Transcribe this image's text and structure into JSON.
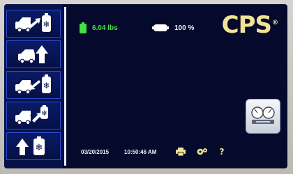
{
  "brand": {
    "logo": "CPS",
    "trademark": "®"
  },
  "status": {
    "weight": "6.04 lbs",
    "battery": "100 %"
  },
  "footer": {
    "date": "03/20/2015",
    "time": "10:50:46 AM",
    "help": "?"
  },
  "sidebar": {
    "items": [
      {
        "icon": "recover-refrigerant-icon"
      },
      {
        "icon": "vacuum-icon"
      },
      {
        "icon": "charge-refrigerant-icon"
      },
      {
        "icon": "recharge-car-icon"
      },
      {
        "icon": "tank-fill-icon"
      }
    ]
  },
  "colors": {
    "accent_green": "#42e242",
    "logo_gold": "#f0e394",
    "screen_bg": "#050a2c",
    "button_border": "#2c4bd0"
  }
}
